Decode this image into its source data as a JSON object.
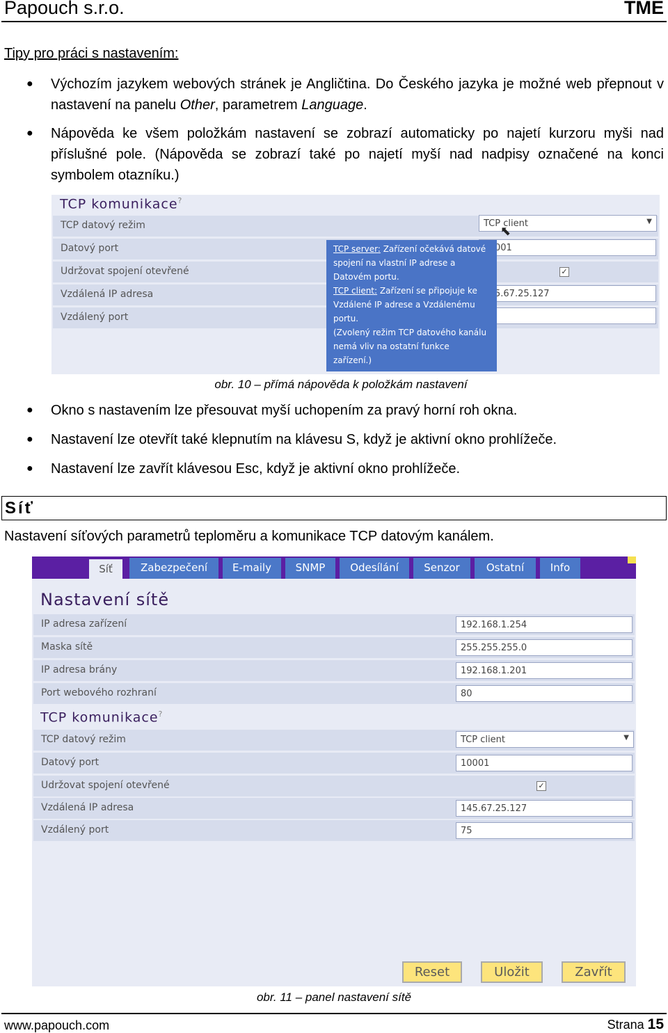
{
  "header": {
    "company": "Papouch s.r.o.",
    "brand": "TME"
  },
  "tips_heading": "Tipy pro práci s nastavením:",
  "bullets1": [
    {
      "parts": [
        "Výchozím jazykem webových stránek je Angličtina. Do Českého jazyka je možné web přepnout v nastavení na panelu ",
        "Other",
        ", parametrem ",
        "Language",
        "."
      ]
    },
    {
      "text": "Nápověda ke všem položkám nastavení se zobrazí automaticky po najetí kurzoru myši nad příslušné pole. (Nápověda se zobrazí také po najetí myší nad nadpisy označené na konci symbolem otazníku.)"
    }
  ],
  "fig10": {
    "heading": "TCP komunikace",
    "help_mark": "?",
    "rows": [
      "TCP datový režim",
      "Datový port",
      "Udržovat spojení otevřené",
      "Vzdálená IP adresa",
      "Vzdálený port"
    ],
    "select_value": "TCP client",
    "port_partial": "001",
    "ip_partial": "5.67.25.127",
    "checked": true,
    "tooltip": {
      "server_label": "TCP server:",
      "server_text": " Zařízení očekává datové spojení na vlastní IP adrese a Datovém portu.",
      "client_label": "TCP client:",
      "client_text": " Zařízení se připojuje ke Vzdálené IP adrese a Vzdálenému portu.",
      "note": "(Zvolený režim TCP datového kanálu nemá vliv na ostatní funkce zařízení.)"
    },
    "caption": "obr. 10 – přímá nápověda k položkám nastavení"
  },
  "bullets2": [
    "Okno s nastavením lze přesouvat myší uchopením za pravý horní roh okna.",
    "Nastavení lze otevřít také klepnutím na klávesu S, když je aktivní okno prohlížeče.",
    "Nastavení lze zavřít klávesou Esc, když je aktivní okno prohlížeče."
  ],
  "section": {
    "title": "Síť",
    "intro": "Nastavení síťových parametrů teploměru a komunikace TCP datovým kanálem."
  },
  "fig11": {
    "tabs": [
      "Síť",
      "Zabezpečení",
      "E-maily",
      "SNMP",
      "Odesílání",
      "Senzor",
      "Ostatní",
      "Info"
    ],
    "active_tab": "Síť",
    "net_heading": "Nastavení sítě",
    "net_rows": [
      {
        "label": "IP adresa zařízení",
        "value": "192.168.1.254"
      },
      {
        "label": "Maska sítě",
        "value": "255.255.255.0"
      },
      {
        "label": "IP adresa brány",
        "value": "192.168.1.201"
      },
      {
        "label": "Port webového rozhraní",
        "value": "80"
      }
    ],
    "tcp_heading": "TCP komunikace",
    "help_mark": "?",
    "tcp_rows": [
      {
        "label": "TCP datový režim",
        "value": "TCP client"
      },
      {
        "label": "Datový port",
        "value": "10001"
      },
      {
        "label": "Udržovat spojení otevřené",
        "checked": true
      },
      {
        "label": "Vzdálená IP adresa",
        "value": "145.67.25.127"
      },
      {
        "label": "Vzdálený port",
        "value": "75"
      }
    ],
    "buttons": {
      "reset": "Reset",
      "save": "Uložit",
      "close": "Zavřít"
    },
    "caption": "obr. 11 – panel nastavení sítě"
  },
  "footer": {
    "url": "www.papouch.com",
    "page_label": "Strana",
    "page_number": "15"
  },
  "colors": {
    "tab_bar": "#5b1fa3",
    "tab": "#4b78c8",
    "panel": "#e8ebf5",
    "row": "#d6dcec",
    "tooltip": "#4a74c6",
    "button": "#fde47c"
  }
}
